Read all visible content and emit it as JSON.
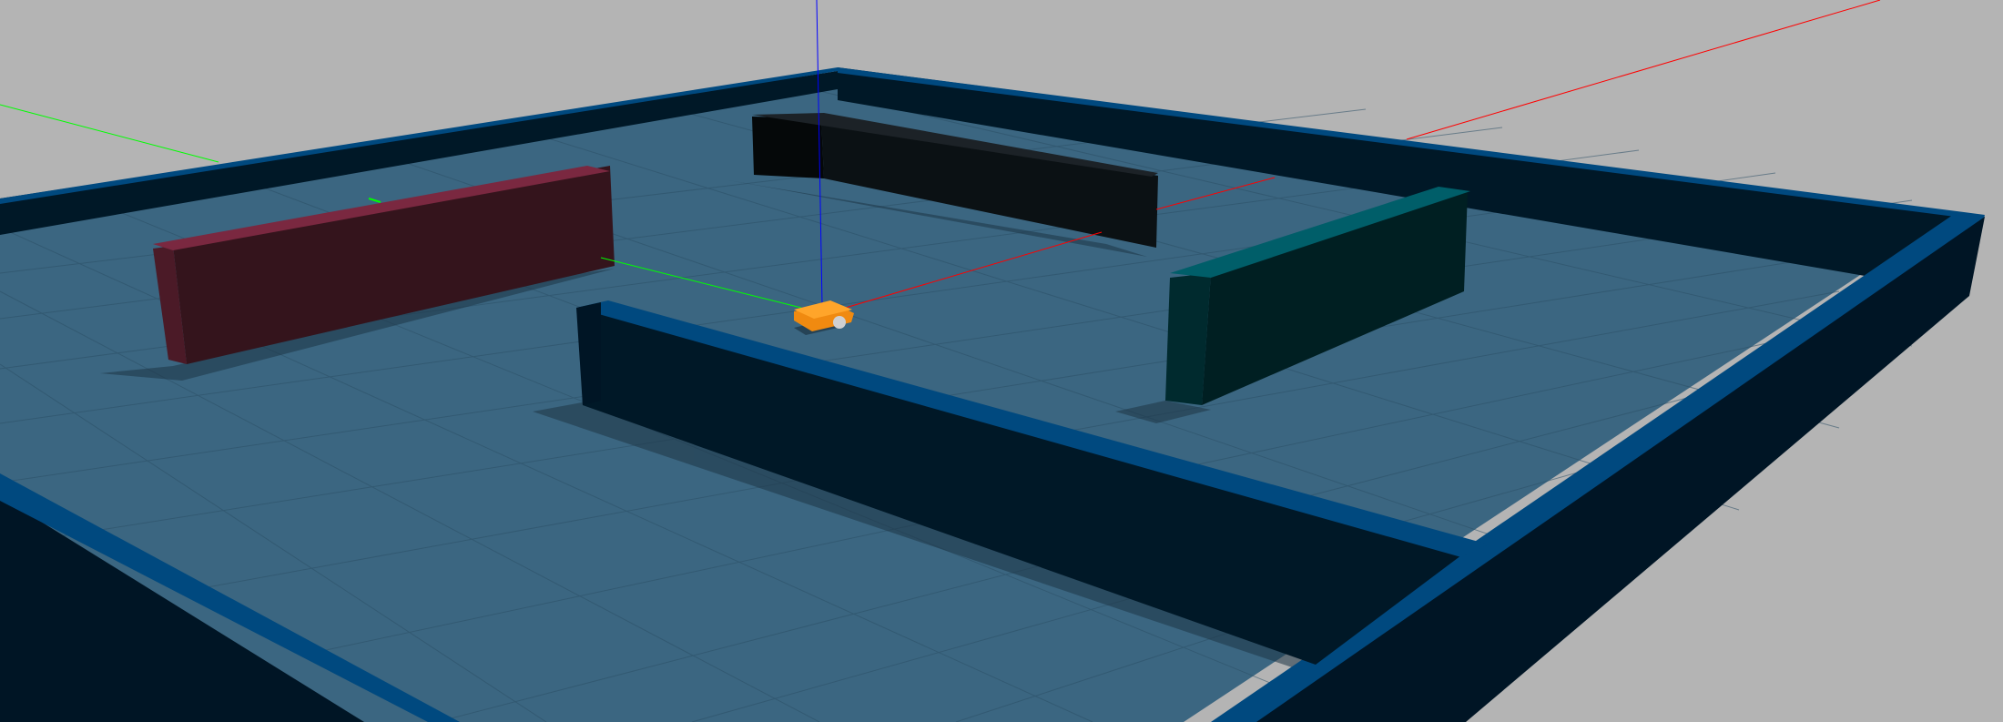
{
  "scene": {
    "background_color": "#b4b4b4",
    "ground_grid_color": "#9a9a9a",
    "floor_color": "#3b6681",
    "floor_grid_color": "#2c5066",
    "wall_top_color": "#00497f",
    "wall_side_color": "#001525",
    "wall_inner_color": "#001827",
    "shadow_color": "#1e3545",
    "obstacles": [
      {
        "name": "red-block",
        "top_color": "#7a2840",
        "front_color": "#34141c",
        "side_color": "#4b1a27"
      },
      {
        "name": "black-block",
        "top_color": "#1c2227",
        "front_color": "#0b1114",
        "side_color": "#050809"
      },
      {
        "name": "teal-block",
        "top_color": "#005e69",
        "front_color": "#001f22",
        "side_color": "#002a2e"
      }
    ],
    "robot": {
      "body_color": "#f08a10",
      "top_color": "#ffa52a",
      "wheel_color": "#d0d0d0"
    },
    "axes": {
      "x_color": "#ff0000",
      "y_color": "#00ff00",
      "z_color": "#0000ff"
    }
  }
}
